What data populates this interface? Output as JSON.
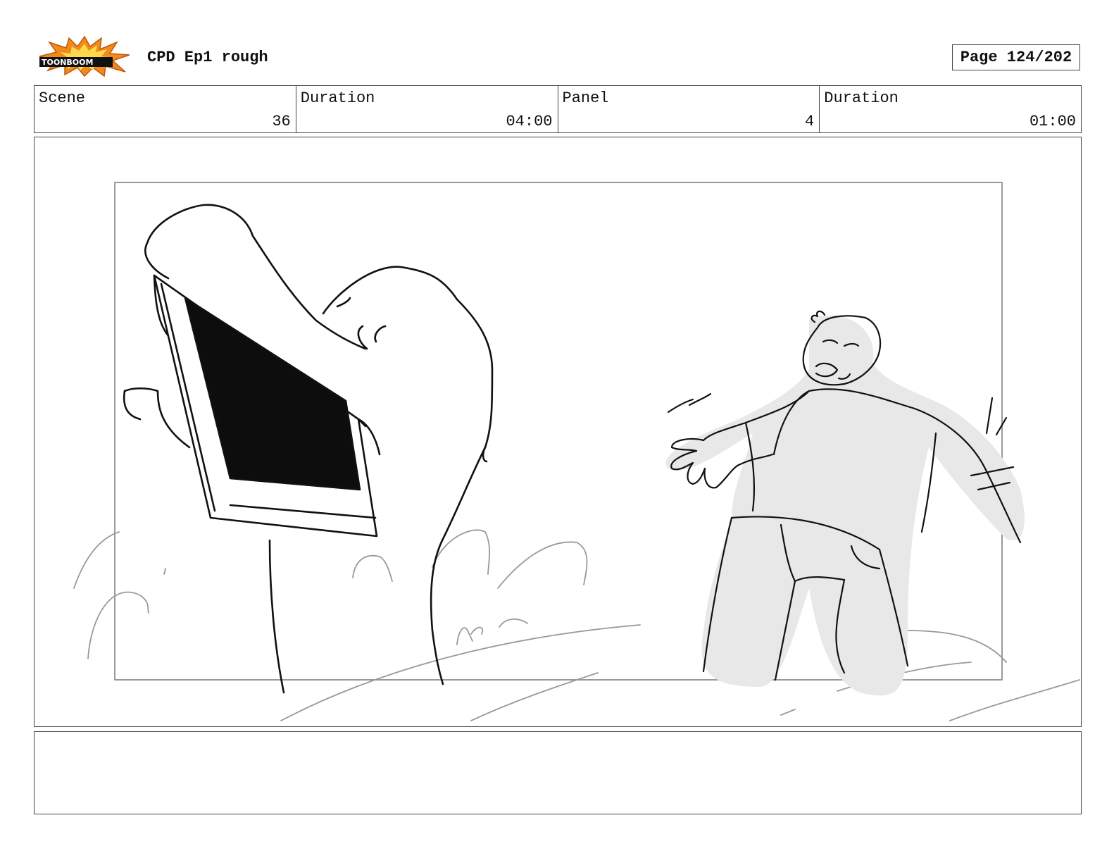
{
  "header": {
    "logo_text": "TOONBOOM",
    "doc_title": "CPD Ep1 rough",
    "page_label": "Page 124/202"
  },
  "info": {
    "scene_label": "Scene",
    "scene_value": "36",
    "scene_duration_label": "Duration",
    "scene_duration_value": "04:00",
    "panel_label": "Panel",
    "panel_value": "4",
    "panel_duration_label": "Duration",
    "panel_duration_value": "01:00"
  },
  "notes": {
    "text": ""
  },
  "colors": {
    "logo_burst": "#f08a1c",
    "frame_gray": "#999999",
    "shade_gray": "#e8e8e8"
  }
}
